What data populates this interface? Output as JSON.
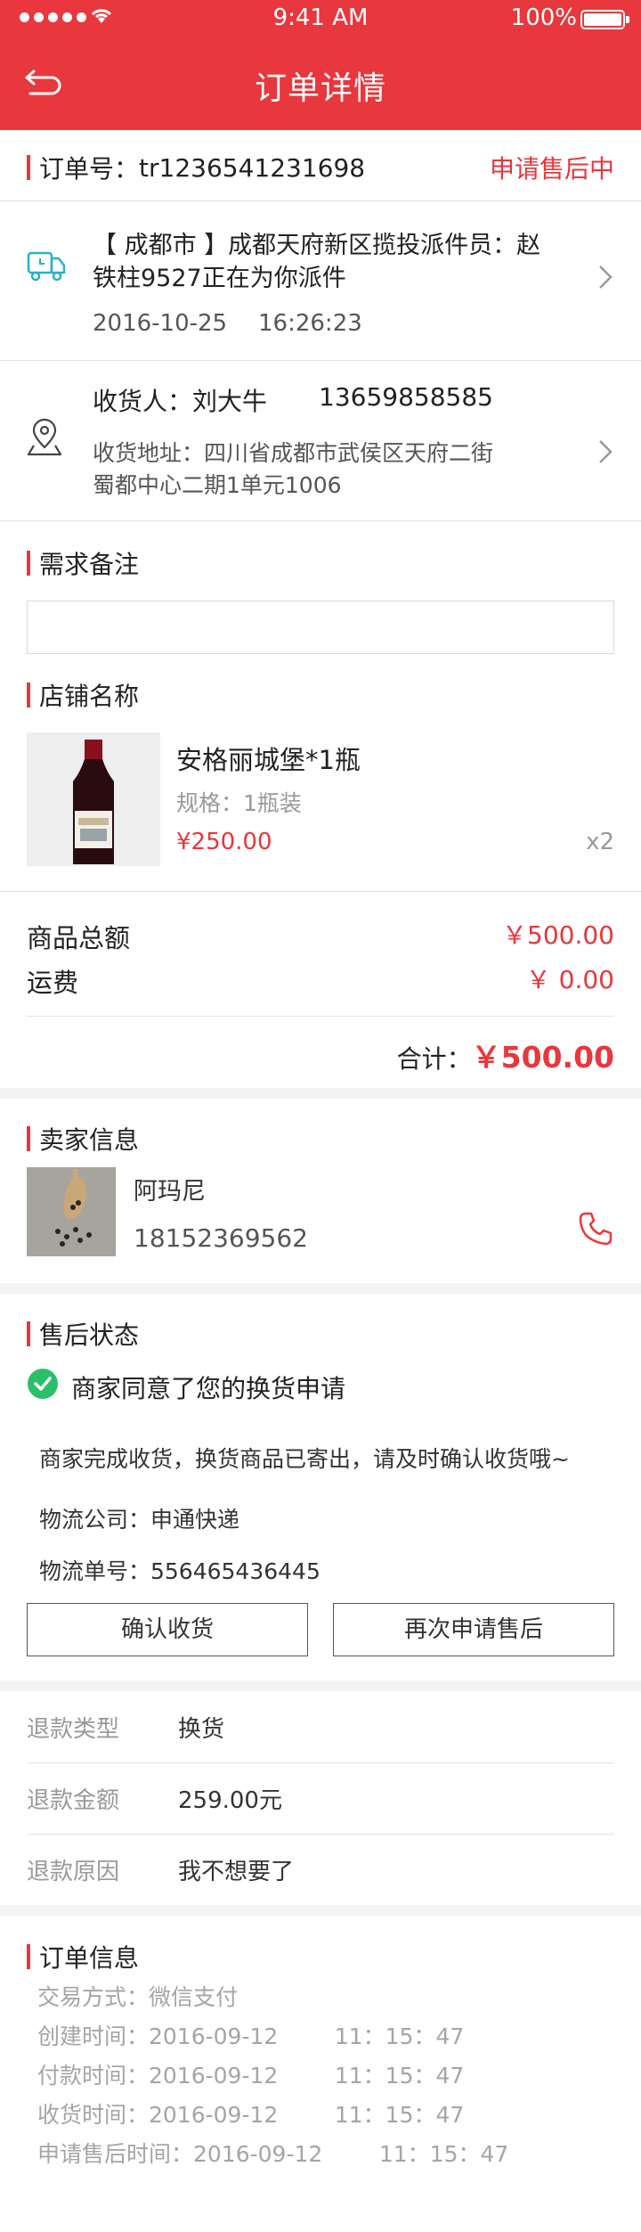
{
  "status_bar": {
    "time": "9:41 AM",
    "battery": "100%"
  },
  "header": {
    "title": "订单详情"
  },
  "order": {
    "number_label": "订单号：",
    "number": "tr1236541231698",
    "status": "申请售后中"
  },
  "delivery": {
    "message": "【 成都市 】成都天府新区揽投派件员：赵铁柱9527正在为你派件",
    "line1": "【 成都市 】成都天府新区揽投派件员：赵",
    "line2": "铁柱9527正在为你派件",
    "date": "2016-10-25",
    "time": "16:26:23"
  },
  "receiver": {
    "name": "收货人：刘大牛",
    "phone": "13659858585",
    "address_line1": "收货地址：四川省成都市武侯区天府二街",
    "address_line2": "蜀都中心二期1单元1006"
  },
  "remark": {
    "title": "需求备注",
    "value": ""
  },
  "store": {
    "title": "店铺名称"
  },
  "product": {
    "name": "安格丽城堡*1瓶",
    "spec": "规格：1瓶装",
    "price": "¥250.00",
    "quantity": "x2"
  },
  "totals": {
    "goods_label": "商品总额",
    "goods_value": "￥500.00",
    "shipping_label": "运费",
    "shipping_value": "￥ 0.00",
    "sum_label": "合计：",
    "sum_value": "￥500.00"
  },
  "seller": {
    "title": "卖家信息",
    "name": "阿玛尼",
    "phone": "18152369562"
  },
  "aftersale": {
    "title": "售后状态",
    "status_text": "商家同意了您的换货申请",
    "message": "商家完成收货，换货商品已寄出，请及时确认收货哦~",
    "courier": "物流公司：申通快递",
    "tracking": "物流单号：556465436445",
    "confirm_label": "确认收货",
    "reapply_label": "再次申请售后"
  },
  "refund": {
    "rows": [
      {
        "label": "退款类型",
        "value": "换货"
      },
      {
        "label": "退款金额",
        "value": "259.00元"
      },
      {
        "label": "退款原因",
        "value": "我不想要了"
      }
    ]
  },
  "order_info": {
    "title": "订单信息",
    "lines": [
      "交易方式：微信支付",
      "创建时间：2016-09-12        11：15：47",
      "付款时间：2016-09-12        11：15：47",
      "收货时间：2016-09-12        11：15：47",
      "申请售后时间：2016-09-12        11：15：47"
    ]
  },
  "colors": {
    "brand": "#e8373d",
    "success": "#2bbf6a",
    "truck": "#2bb0c8"
  },
  "icons": {
    "back": "back-arrow-icon",
    "truck": "delivery-truck-icon",
    "location": "location-pin-icon",
    "chevron": "chevron-right-icon",
    "phone": "phone-icon",
    "check": "check-circle-icon"
  }
}
